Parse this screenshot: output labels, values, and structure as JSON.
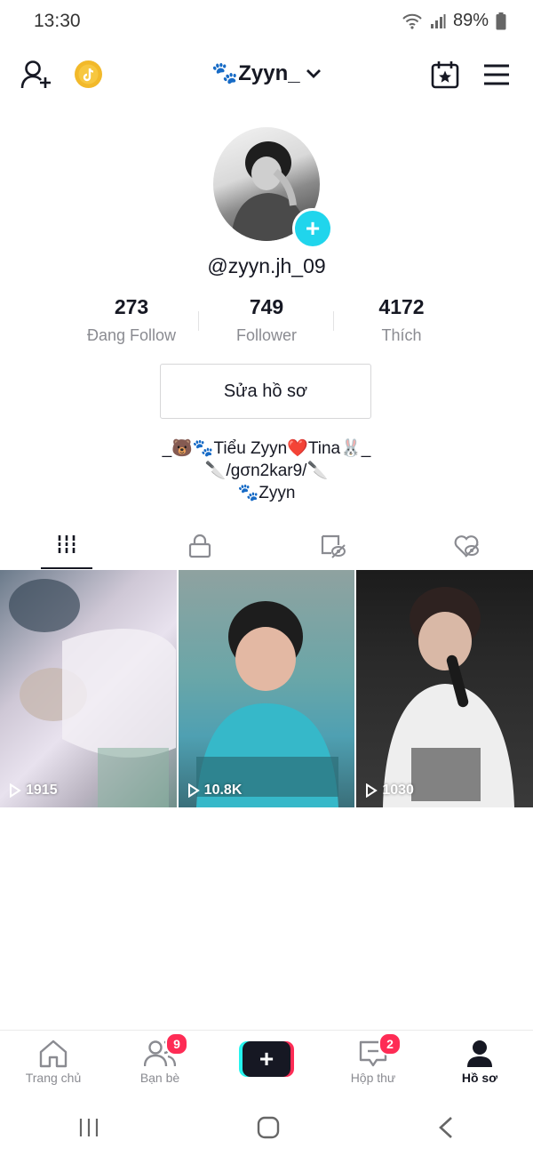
{
  "status": {
    "time": "13:30",
    "battery": "89%"
  },
  "header": {
    "username": "🐾Zyyn_"
  },
  "profile": {
    "handle": "@zyyn.jh_09",
    "stats": [
      {
        "value": "273",
        "label": "Đang Follow"
      },
      {
        "value": "749",
        "label": "Follower"
      },
      {
        "value": "4172",
        "label": "Thích"
      }
    ],
    "edit_label": "Sửa hồ sơ",
    "bio_lines": [
      "_🐻🐾Tiểu Zyyn❤️Tina🐰_",
      "🔪/gσn2kar9/🔪",
      "🐾Zyyn"
    ]
  },
  "videos": [
    {
      "views": "1915"
    },
    {
      "views": "10.8K"
    },
    {
      "views": "1030"
    }
  ],
  "nav": {
    "home": "Trang chủ",
    "friends": "Bạn bè",
    "friends_badge": "9",
    "inbox": "Hộp thư",
    "inbox_badge": "2",
    "profile": "Hồ sơ"
  },
  "colors": {
    "accent_cyan": "#20d5ec",
    "accent_red": "#fe2c55",
    "text": "#161823",
    "muted": "#8a8b91"
  }
}
